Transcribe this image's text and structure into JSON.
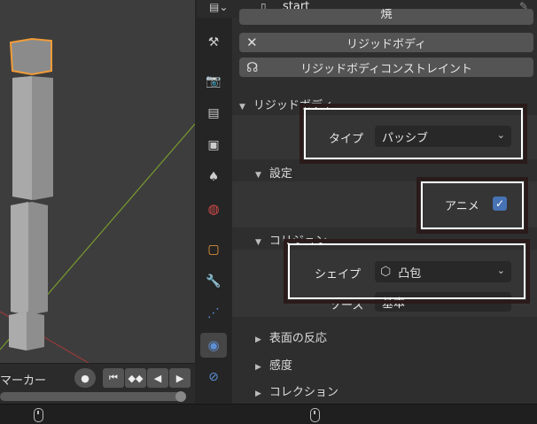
{
  "header": {
    "object_name": "start"
  },
  "buttons": {
    "top_partial": "焼",
    "rigid_body": "リジッドボディ",
    "rigid_body_constraint": "リジッドボディコンストレイント"
  },
  "section": {
    "rigid_body": "リジッドボディ"
  },
  "settings": {
    "type_label": "タイプ",
    "type_value": "パッシブ",
    "subsection_settings": "設定",
    "animated_label": "アニメ",
    "animated_checked": true,
    "subsection_collision": "コリジョン",
    "shape_label": "シェイプ",
    "shape_value": "凸包",
    "source_label": "ソース",
    "source_value": "基本"
  },
  "collapsed_sections": {
    "surface_response": "表面の反応",
    "sensitivity": "感度",
    "collections": "コレクション"
  },
  "timeline": {
    "marker_label": "マーカー"
  },
  "colors": {
    "accent": "#4772b3",
    "selection": "#f29c38",
    "panel": "#2e2e2e"
  }
}
